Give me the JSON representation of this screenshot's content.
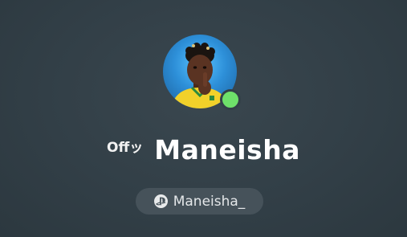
{
  "profile": {
    "prefix": "Offッ",
    "display_name": "Maneisha",
    "psn_id": "Maneisha_",
    "online_status": "online",
    "avatar_icon": "avatar-shush-icon",
    "platform_icon": "playstation-icon"
  },
  "colors": {
    "background": "#323f47",
    "online": "#6ee06a",
    "pill": "#46525a",
    "text": "#ffffff"
  }
}
